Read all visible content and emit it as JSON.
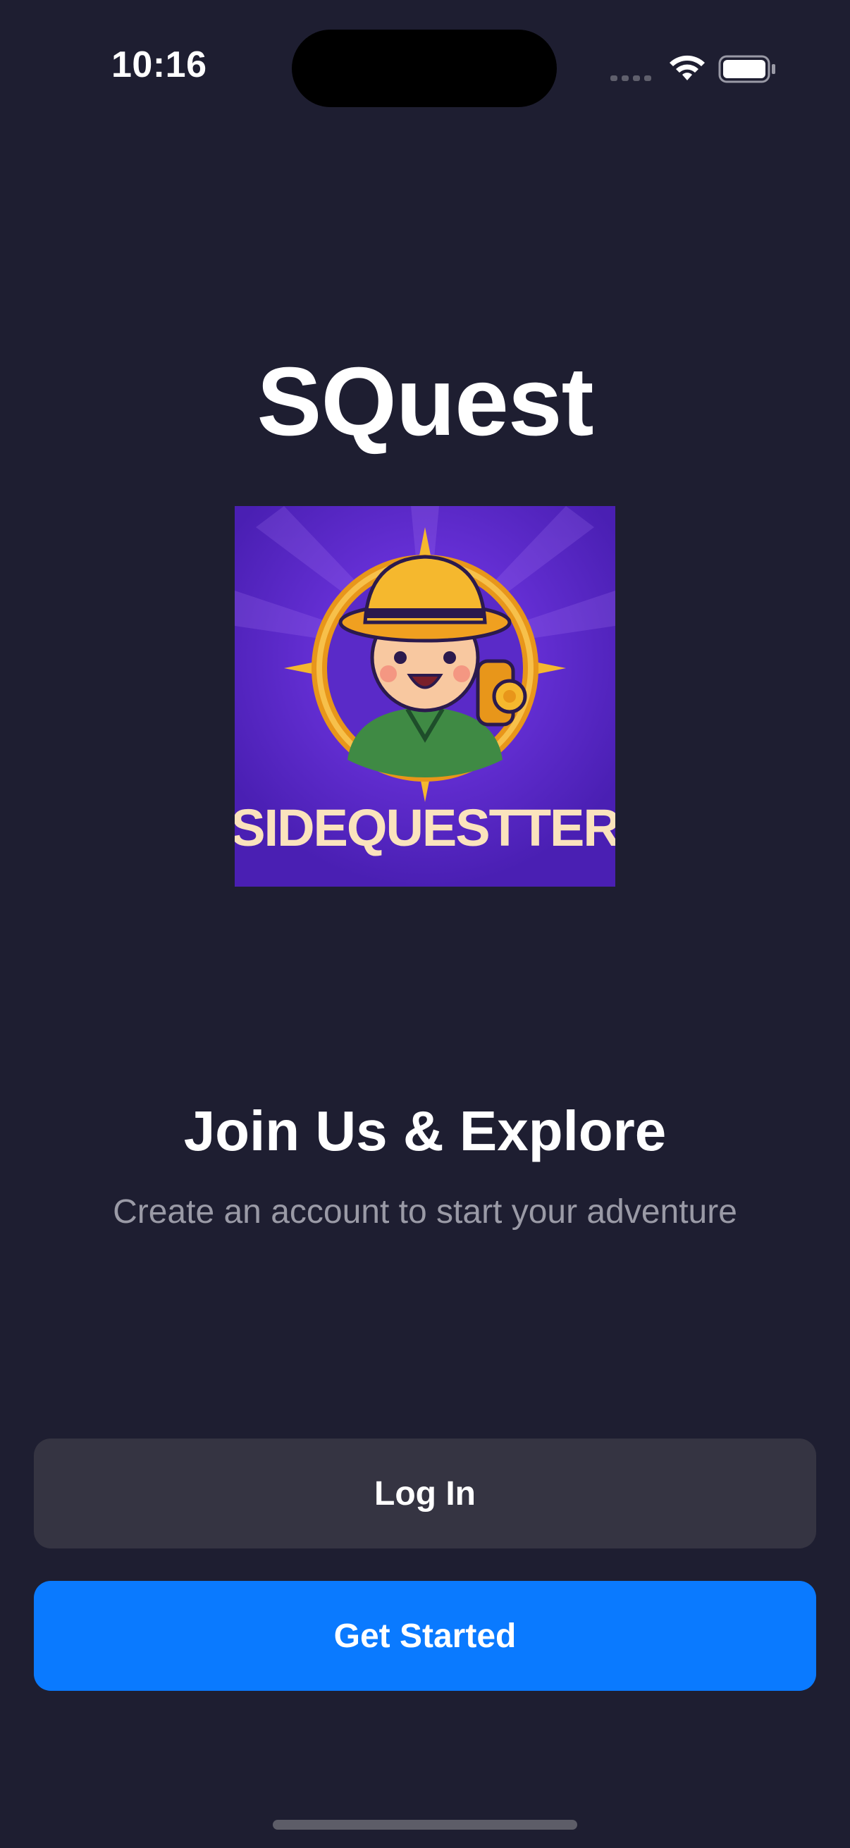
{
  "status_bar": {
    "time": "10:16",
    "icons": [
      "cellular-signal-icon",
      "wifi-icon",
      "battery-icon"
    ]
  },
  "app": {
    "title": "SQuest",
    "logo": {
      "text": "SIDEQUESTTER",
      "colors": {
        "background": "#4a1fb3",
        "gold": "#f5a623",
        "text": "#fbe3bd"
      }
    }
  },
  "welcome": {
    "heading": "Join Us & Explore",
    "subheading": "Create an account to start your adventure"
  },
  "actions": {
    "login_label": "Log In",
    "get_started_label": "Get Started"
  },
  "colors": {
    "background": "#1e1e31",
    "primary": "#0a7aff",
    "secondary_button": "#353442",
    "muted_text": "#9a9aa6"
  }
}
